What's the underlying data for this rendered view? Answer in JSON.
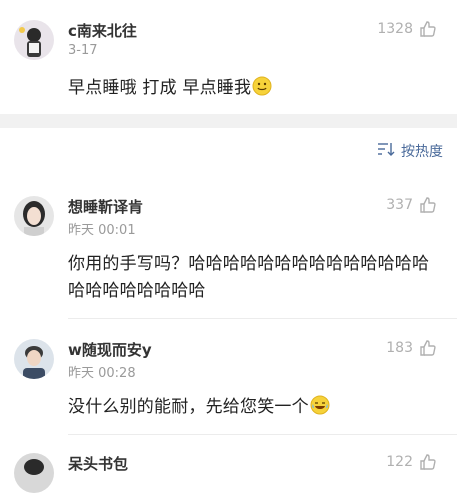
{
  "comments": [
    {
      "username": "c南来北往",
      "time": "3-17",
      "likes": "1328",
      "text": "早点睡哦 打成 早点睡我",
      "emoji": "smile"
    },
    {
      "username": "想睡靳译肯",
      "time": "昨天 00:01",
      "likes": "337",
      "text": "你用的手写吗？哈哈哈哈哈哈哈哈哈哈哈哈哈哈哈哈哈哈哈哈哈哈"
    },
    {
      "username": "w随现而安y",
      "time": "昨天 00:28",
      "likes": "183",
      "text": "没什么别的能耐，先给您笑一个",
      "emoji": "laugh-cry"
    },
    {
      "username": "呆头书包",
      "likes": "122"
    }
  ],
  "sort": {
    "label": "按热度",
    "icon": "sort-icon"
  },
  "colors": {
    "link": "#4a6a9a",
    "meta": "#9a9a9a",
    "separator": "#f1f1f1"
  }
}
